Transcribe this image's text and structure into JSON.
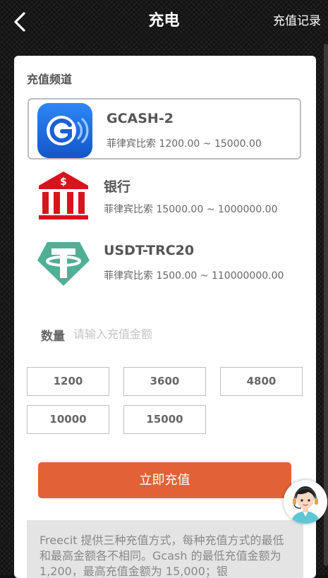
{
  "header": {
    "title": "充电",
    "records_label": "充值记录"
  },
  "channels_section": {
    "title": "充值频道",
    "items": [
      {
        "name": "GCASH-2",
        "range": "菲律宾比索 1200.00 ~ 15000.00",
        "icon": "gcash-icon",
        "selected": true
      },
      {
        "name": "银行",
        "range": "菲律宾比索 15000.00 ~ 1000000.00",
        "icon": "bank-icon",
        "selected": false
      },
      {
        "name": "USDT-TRC20",
        "range": "菲律宾比索 1500.00 ~ 110000000.00",
        "icon": "tether-icon",
        "selected": false
      }
    ]
  },
  "amount": {
    "label": "数量",
    "placeholder": "请输入充值金额",
    "value": ""
  },
  "presets": [
    "1200",
    "3600",
    "4800",
    "10000",
    "15000"
  ],
  "submit_label": "立即充值",
  "notice": "Freecit 提供三种充值方式，每种充值方式的最低和最高金额各不相同。Gcash 的最低充值金额为 1,200，最高充值金额为 15,000；银",
  "colors": {
    "accent": "#e06236",
    "gcash_blue": "#1e6fe6",
    "bank_red": "#d7141e",
    "tether_green": "#50af95"
  }
}
